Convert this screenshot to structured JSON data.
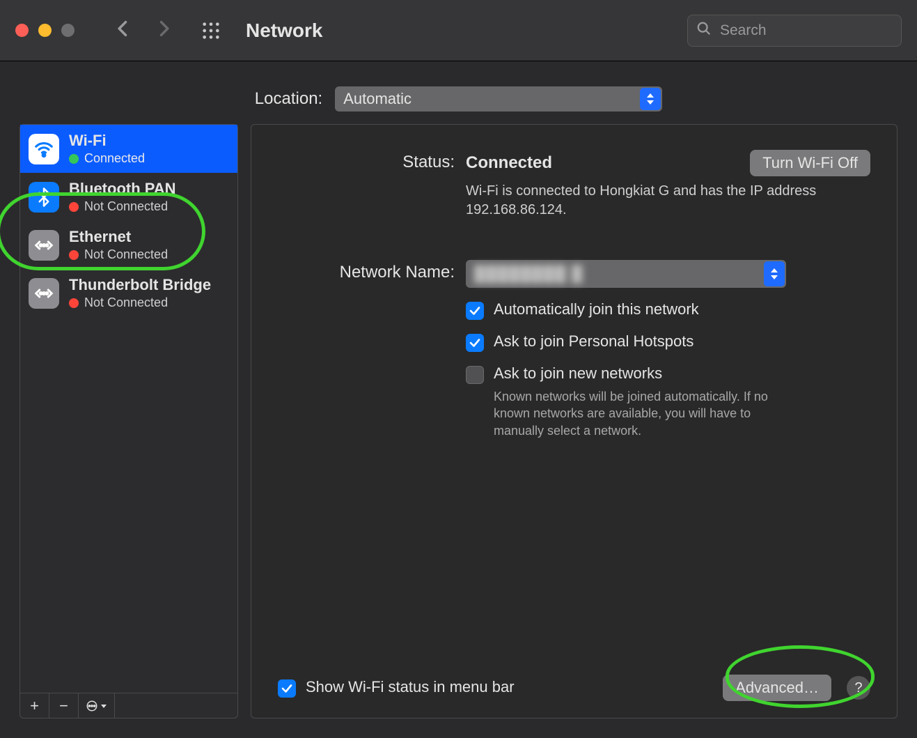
{
  "toolbar": {
    "title": "Network",
    "search_placeholder": "Search"
  },
  "location": {
    "label": "Location:",
    "value": "Automatic"
  },
  "services": [
    {
      "name": "Wi-Fi",
      "status": "Connected",
      "dot": "green",
      "icon": "wifi",
      "bg": "white",
      "selected": true
    },
    {
      "name": "Bluetooth PAN",
      "status": "Not Connected",
      "dot": "orange",
      "icon": "bluetooth",
      "bg": "blue",
      "selected": false
    },
    {
      "name": "Ethernet",
      "status": "Not Connected",
      "dot": "orange",
      "icon": "ethernet",
      "bg": "grey",
      "selected": false
    },
    {
      "name": "Thunderbolt Bridge",
      "status": "Not Connected",
      "dot": "orange",
      "icon": "thunderbolt",
      "bg": "grey",
      "selected": false
    }
  ],
  "list_footer": {
    "add": "+",
    "remove": "−"
  },
  "detail": {
    "status_label": "Status:",
    "status_value": "Connected",
    "toggle_button": "Turn Wi-Fi Off",
    "status_sub": "Wi-Fi is connected to Hongkiat G and has the IP address 192.168.86.124.",
    "network_name_label": "Network Name:",
    "network_name_value": "████████ █",
    "auto_join_label": "Automatically join this network",
    "ask_hotspot_label": "Ask to join Personal Hotspots",
    "ask_new_label": "Ask to join new networks",
    "ask_new_hint": "Known networks will be joined automatically. If no known networks are available, you will have to manually select a network.",
    "show_menubar_label": "Show Wi-Fi status in menu bar",
    "advanced_button": "Advanced…",
    "help": "?"
  }
}
